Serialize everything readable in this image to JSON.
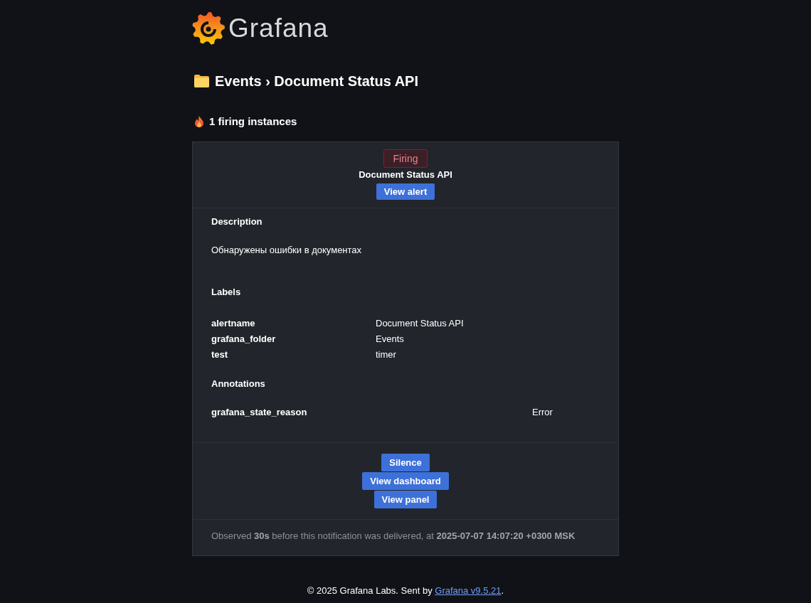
{
  "logo": {
    "text": "Grafana"
  },
  "heading": "Events › Document Status API",
  "firing_summary": "1 firing instances",
  "alert": {
    "status": {
      "label": "Firing",
      "kind": "firing"
    },
    "name": "Document Status API",
    "view_button": "View alert",
    "description": {
      "title": "Description",
      "text": "Обнаружены ошибки в документах"
    },
    "labels": {
      "title": "Labels",
      "rows": [
        {
          "key": "alertname",
          "value": "Document Status API"
        },
        {
          "key": "grafana_folder",
          "value": "Events"
        },
        {
          "key": "test",
          "value": "timer"
        }
      ]
    },
    "annotations": {
      "title": "Annotations",
      "rows": [
        {
          "key": "grafana_state_reason",
          "value": "Error"
        }
      ]
    },
    "actions": [
      "Silence",
      "View dashboard",
      "View panel"
    ],
    "observed": "Observed **30s** before this notification was delivered, at **2025-07-07 14:07:20 +0300 MSK**"
  },
  "footer": {
    "text": "© 2025 Grafana Labs. Sent by",
    "link": "Grafana v9.5.21",
    "suffix": "."
  }
}
